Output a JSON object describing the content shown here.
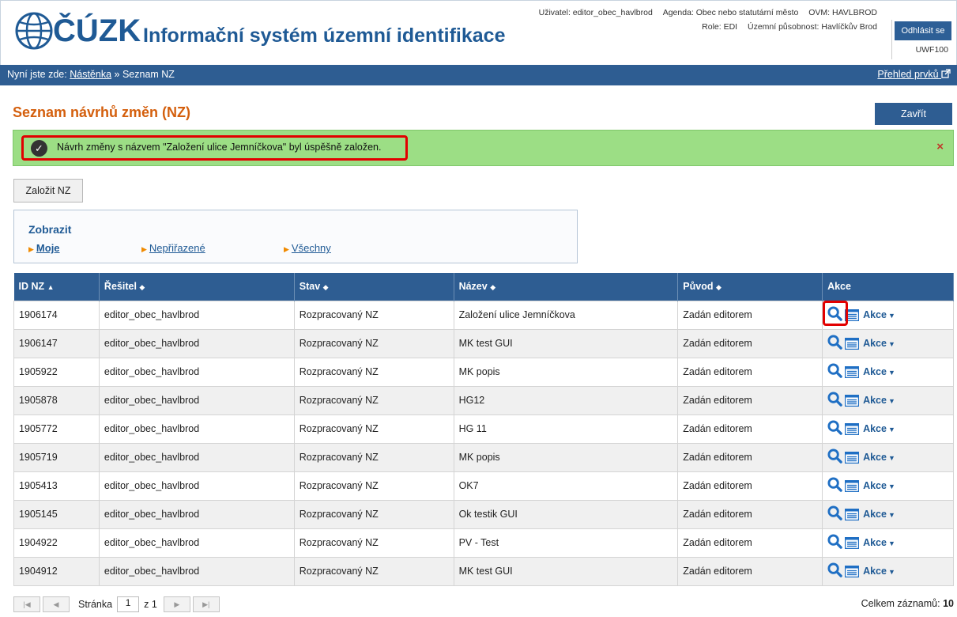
{
  "header": {
    "logo_text": "ÚZK",
    "logo_text_prefix": "Č",
    "app_title": "Informační systém územní identifikace",
    "user_label": "Uživatel: editor_obec_havlbrod",
    "agenda_label": "Agenda: Obec nebo statutární město",
    "ovm_label": "OVM: HAVLBROD",
    "role_label": "Role: EDI",
    "territory_label": "Územní působnost: Havlíčkův Brod",
    "uwf_code": "UWF100",
    "logout_label": "Odhlásit se"
  },
  "breadcrumb": {
    "prefix": "Nyní jste zde:",
    "home": "Nástěnka",
    "separator": "»",
    "current": "Seznam NZ",
    "overview_link": "Přehled prvků"
  },
  "page": {
    "title": "Seznam návrhů změn (NZ)",
    "close_label": "Zavřít"
  },
  "alert": {
    "message": "Návrh změny s názvem \"Založení ulice Jemníčkova\" byl úspěšně založen.",
    "close_symbol": "×"
  },
  "create_button": "Založit NZ",
  "filter": {
    "title": "Zobrazit",
    "options": [
      "Moje",
      "Nepřiřazené",
      "Všechny"
    ]
  },
  "table": {
    "columns": [
      "ID NZ",
      "Řešitel",
      "Stav",
      "Název",
      "Původ",
      "Akce"
    ],
    "sort_up": "▲",
    "sort_both": "◆",
    "action_label": "Akce",
    "rows": [
      {
        "id": "1906174",
        "solver": "editor_obec_havlbrod",
        "state": "Rozpracovaný NZ",
        "name": "Založení ulice Jemníčkova",
        "origin": "Zadán editorem"
      },
      {
        "id": "1906147",
        "solver": "editor_obec_havlbrod",
        "state": "Rozpracovaný NZ",
        "name": "MK test GUI",
        "origin": "Zadán editorem"
      },
      {
        "id": "1905922",
        "solver": "editor_obec_havlbrod",
        "state": "Rozpracovaný NZ",
        "name": "MK popis",
        "origin": "Zadán editorem"
      },
      {
        "id": "1905878",
        "solver": "editor_obec_havlbrod",
        "state": "Rozpracovaný NZ",
        "name": "HG12",
        "origin": "Zadán editorem"
      },
      {
        "id": "1905772",
        "solver": "editor_obec_havlbrod",
        "state": "Rozpracovaný NZ",
        "name": "HG 11",
        "origin": "Zadán editorem"
      },
      {
        "id": "1905719",
        "solver": "editor_obec_havlbrod",
        "state": "Rozpracovaný NZ",
        "name": "MK popis",
        "origin": "Zadán editorem"
      },
      {
        "id": "1905413",
        "solver": "editor_obec_havlbrod",
        "state": "Rozpracovaný NZ",
        "name": "OK7",
        "origin": "Zadán editorem"
      },
      {
        "id": "1905145",
        "solver": "editor_obec_havlbrod",
        "state": "Rozpracovaný NZ",
        "name": "Ok testik GUI",
        "origin": "Zadán editorem"
      },
      {
        "id": "1904922",
        "solver": "editor_obec_havlbrod",
        "state": "Rozpracovaný NZ",
        "name": "PV - Test",
        "origin": "Zadán editorem"
      },
      {
        "id": "1904912",
        "solver": "editor_obec_havlbrod",
        "state": "Rozpracovaný NZ",
        "name": "MK test GUI",
        "origin": "Zadán editorem"
      }
    ]
  },
  "pager": {
    "page_label": "Stránka",
    "page_value": "1",
    "of_label": "z 1",
    "total_label": "Celkem záznamů:",
    "total_value": "10"
  },
  "colors": {
    "brand_blue": "#2e5d92",
    "title_orange": "#d45f0d",
    "success_green": "#9cde85",
    "highlight_red": "#e20000"
  }
}
